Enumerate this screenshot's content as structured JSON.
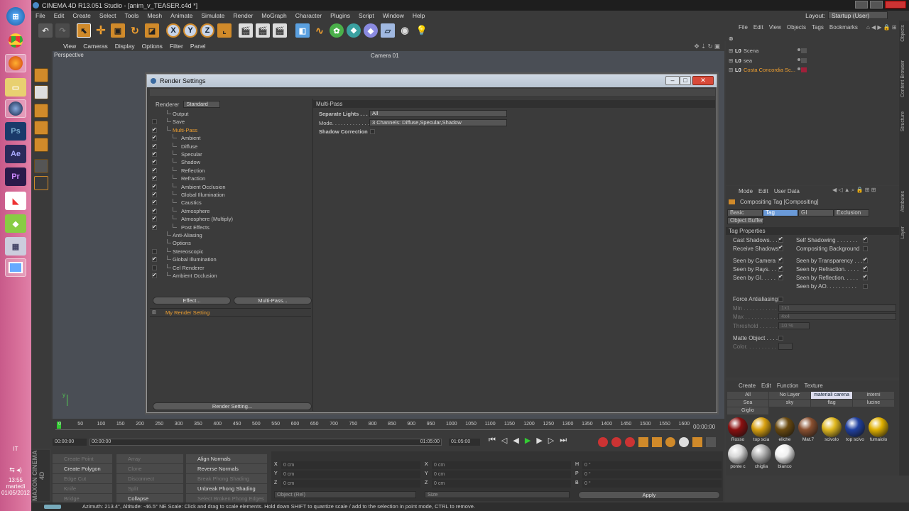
{
  "window_title": "CINEMA 4D R13.051 Studio - [anim_v_TEASER.c4d *]",
  "menu": [
    "File",
    "Edit",
    "Create",
    "Select",
    "Tools",
    "Mesh",
    "Animate",
    "Simulate",
    "Render",
    "MoGraph",
    "Character",
    "Plugins",
    "Script",
    "Window",
    "Help"
  ],
  "layout": {
    "label": "Layout:",
    "value": "Startup (User)"
  },
  "toolbar_axes": [
    "X",
    "Y",
    "Z"
  ],
  "viewport": {
    "menu": [
      "View",
      "Cameras",
      "Display",
      "Options",
      "Filter",
      "Panel"
    ],
    "name": "Perspective",
    "camera": "Camera 01"
  },
  "dialog": {
    "title": "Render Settings",
    "renderer_label": "Renderer",
    "renderer_value": "Standard",
    "tree": [
      {
        "label": "Output",
        "check": "none",
        "level": 0,
        "active": false
      },
      {
        "label": "Save",
        "check": "empty",
        "level": 0,
        "active": false
      },
      {
        "label": "Multi-Pass",
        "check": "checked",
        "level": 0,
        "active": true
      },
      {
        "label": "Ambient",
        "check": "checked",
        "level": 1,
        "active": false
      },
      {
        "label": "Diffuse",
        "check": "checked",
        "level": 1,
        "active": false
      },
      {
        "label": "Specular",
        "check": "checked",
        "level": 1,
        "active": false
      },
      {
        "label": "Shadow",
        "check": "checked",
        "level": 1,
        "active": false
      },
      {
        "label": "Reflection",
        "check": "checked",
        "level": 1,
        "active": false
      },
      {
        "label": "Refraction",
        "check": "checked",
        "level": 1,
        "active": false
      },
      {
        "label": "Ambient Occlusion",
        "check": "checked",
        "level": 1,
        "active": false
      },
      {
        "label": "Global Illumination",
        "check": "checked",
        "level": 1,
        "active": false
      },
      {
        "label": "Caustics",
        "check": "checked",
        "level": 1,
        "active": false
      },
      {
        "label": "Atmosphere",
        "check": "checked",
        "level": 1,
        "active": false
      },
      {
        "label": "Atmosphere (Multiply)",
        "check": "checked",
        "level": 1,
        "active": false
      },
      {
        "label": "Post Effects",
        "check": "checked",
        "level": 1,
        "active": false
      },
      {
        "label": "Anti-Aliasing",
        "check": "none",
        "level": 0,
        "active": false
      },
      {
        "label": "Options",
        "check": "none",
        "level": 0,
        "active": false
      },
      {
        "label": "Stereoscopic",
        "check": "empty",
        "level": 0,
        "active": false
      },
      {
        "label": "Global Illumination",
        "check": "checked",
        "level": 0,
        "active": false
      },
      {
        "label": "Cel Renderer",
        "check": "empty",
        "level": 0,
        "active": false
      },
      {
        "label": "Ambient Occlusion",
        "check": "checked",
        "level": 0,
        "active": false
      }
    ],
    "effect_button": "Effect...",
    "multipass_button": "Multi-Pass...",
    "render_setting_name": "My Render Setting",
    "render_setting_button": "Render Setting...",
    "panel_title": "Multi-Pass",
    "separate_lights_label": "Separate Lights . . .",
    "separate_lights_value": "All",
    "mode_label": "Mode. . . . . . . . . . . . .",
    "mode_value": "3 Channels: Diffuse,Specular,Shadow",
    "shadow_correction_label": "Shadow Correction"
  },
  "object_manager": {
    "menu": [
      "File",
      "Edit",
      "View",
      "Objects",
      "Tags",
      "Bookmarks"
    ],
    "objects": [
      {
        "name": "Scena",
        "color": "#c8c8c8"
      },
      {
        "name": "sea",
        "color": "#c8c8c8"
      },
      {
        "name": "Costa Concordia Sc...",
        "color": "#f0a030"
      }
    ]
  },
  "attributes": {
    "menu": [
      "Mode",
      "Edit",
      "User Data"
    ],
    "title": "Compositing Tag [Compositing]",
    "tabs": [
      "Basic",
      "Tag",
      "GI",
      "Exclusion"
    ],
    "active_tab": "Tag",
    "tab2": "Object Buffer",
    "section": "Tag Properties",
    "props_left": [
      {
        "label": "Cast Shadows. . . .",
        "checked": true
      },
      {
        "label": "Receive Shadows",
        "checked": true
      },
      {
        "label": "Seen by Camera",
        "checked": true
      },
      {
        "label": "Seen by Rays. . .",
        "checked": true
      },
      {
        "label": "Seen by GI. . . . .",
        "checked": true
      }
    ],
    "props_right": [
      {
        "label": "Self Shadowing . . . . . . .",
        "checked": true
      },
      {
        "label": "Compositing Background",
        "checked": false
      },
      {
        "label": "Seen by Transparency . . .",
        "checked": true
      },
      {
        "label": "Seen by Refraction. . . . .",
        "checked": true
      },
      {
        "label": "Seen by Reflection. . . . .",
        "checked": true
      },
      {
        "label": "Seen by AO. . . . . . . . . .",
        "checked": false
      }
    ],
    "force_aa": "Force Antialiasing",
    "min_label": "Min . . . . . . . . . . . .",
    "min_value": "1x1",
    "max_label": "Max . . . . . . . . . . . .",
    "max_value": "4x4",
    "threshold_label": "Threshold . . . . . . . .",
    "threshold_value": "10 %",
    "matte_label": "Matte Object . . . .",
    "color_label": "Color. . . . . . . . . . ."
  },
  "materials": {
    "menu": [
      "Create",
      "Edit",
      "Function",
      "Texture"
    ],
    "layers": [
      "All",
      "No Layer",
      "materiali carena",
      "interni",
      "Sea",
      "sky",
      "flag",
      "lucine",
      "Giglio"
    ],
    "items": [
      {
        "name": "Rosso",
        "color": "#8a1010"
      },
      {
        "name": "top scia",
        "color": "#d8a010"
      },
      {
        "name": "eliche",
        "color": "#6a4a10"
      },
      {
        "name": "Mat.7",
        "color": "#8a5030"
      },
      {
        "name": "scivolo",
        "color": "#e0b820"
      },
      {
        "name": "top scivo",
        "color": "#2040a0"
      },
      {
        "name": "fumaiolo",
        "color": "#e0b000"
      },
      {
        "name": "ponte c",
        "color": "#d8d8d8"
      },
      {
        "name": "chiglia",
        "color": "#b0b0b0"
      },
      {
        "name": "bianco",
        "color": "#f0f0f0"
      }
    ]
  },
  "timeline": {
    "ticks": [
      "0",
      "50",
      "100",
      "150",
      "200",
      "250",
      "300",
      "350",
      "400",
      "450",
      "500",
      "550",
      "600",
      "650",
      "700",
      "750",
      "800",
      "850",
      "900",
      "950",
      "1000",
      "1050",
      "1100",
      "1150",
      "1200",
      "1250",
      "1300",
      "1350",
      "1400",
      "1450",
      "1500",
      "1550",
      "1600"
    ],
    "current": "00:00:00",
    "start": "00:00:00",
    "field2": "00:00:00",
    "end_a": "01:05:00",
    "end_b": "01:05:00"
  },
  "tools_left": {
    "col1": [
      "Create Point",
      "Create Polygon",
      "Edge Cut",
      "Knife",
      "Bridge"
    ],
    "col2": [
      "Array",
      "Clone",
      "Disconnect",
      "Split",
      "Collapse"
    ],
    "col3": [
      "Align Normals",
      "Reverse Normals",
      "Break Phong Shading",
      "Unbreak Phong Shading",
      "Select Broken Phong Edges"
    ]
  },
  "coords": {
    "rows": [
      {
        "a": "X",
        "av": "0 cm",
        "b": "X",
        "bv": "0 cm",
        "c": "H",
        "cv": "0 °"
      },
      {
        "a": "Y",
        "av": "0 cm",
        "b": "Y",
        "bv": "0 cm",
        "c": "P",
        "cv": "0 °"
      },
      {
        "a": "Z",
        "av": "0 cm",
        "b": "Z",
        "bv": "0 cm",
        "c": "B",
        "cv": "0 °"
      }
    ],
    "mode": "Object (Rel)",
    "size": "Size",
    "apply": "Apply"
  },
  "status": "Azimuth: 213.4°, Altitude: -46.5° NE  Scale: Click and drag to scale elements. Hold down SHIFT to quantize scale / add to the selection in point mode, CTRL to remove.",
  "taskbar": {
    "lang": "IT",
    "time": "13:55",
    "day": "martedì",
    "date": "01/05/2012"
  }
}
